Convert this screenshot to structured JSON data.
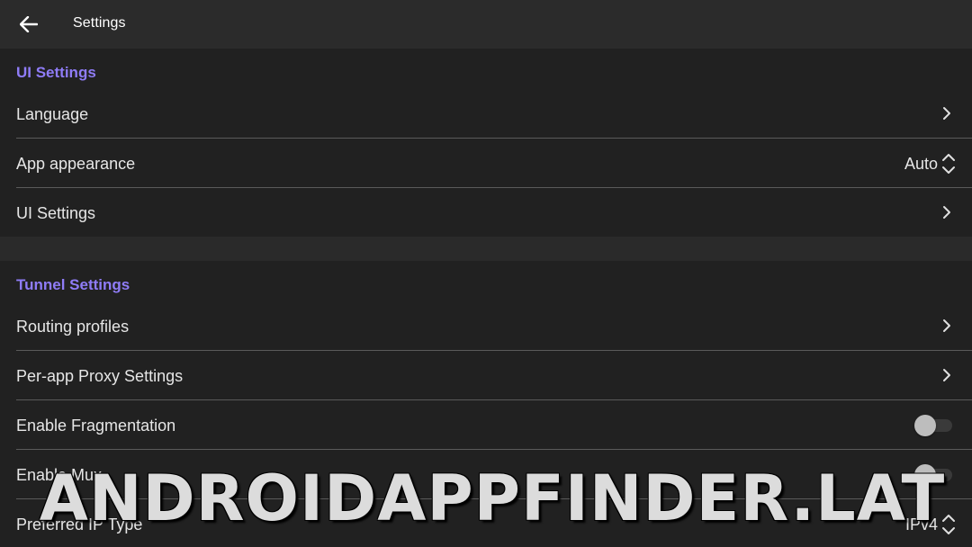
{
  "toolbar": {
    "title": "Settings",
    "back_icon": "arrow-left-icon"
  },
  "ui_section": {
    "header": "UI Settings",
    "items": [
      {
        "label": "Language",
        "control": "chevron"
      },
      {
        "label": "App appearance",
        "control": "select",
        "value": "Auto"
      },
      {
        "label": "UI Settings",
        "control": "chevron"
      }
    ]
  },
  "tunnel_section": {
    "header": "Tunnel Settings",
    "items": [
      {
        "label": "Routing profiles",
        "control": "chevron"
      },
      {
        "label": "Per-app Proxy Settings",
        "control": "chevron"
      },
      {
        "label": "Enable Fragmentation",
        "control": "switch",
        "checked": false
      },
      {
        "label": "Enable Mux",
        "control": "switch",
        "checked": false
      },
      {
        "label": "Preferred IP Type",
        "control": "select",
        "value": "IPv4"
      }
    ]
  },
  "watermark": "ANDROIDAPPFINDER.LAT",
  "colors": {
    "accent": "#8f7cf7",
    "background": "#1f1f1f",
    "toolbar": "#2b2b2b",
    "divider": "#5a5a5a"
  }
}
